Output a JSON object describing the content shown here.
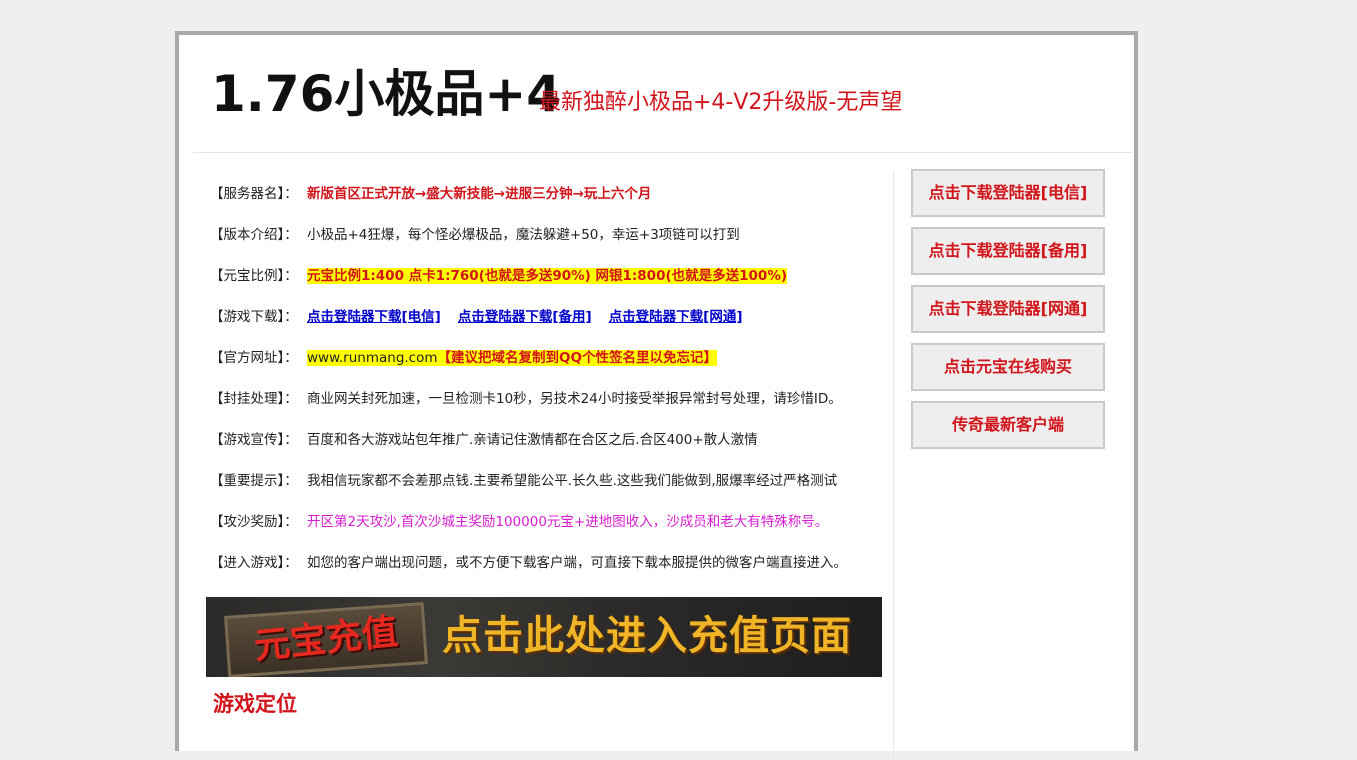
{
  "header": {
    "title": "1.76小极品+4",
    "subtitle": "最新独醉小极品+4-V2升级版-无声望"
  },
  "info": {
    "server_name": {
      "label": "【服务器名】：",
      "value": "新版首区正式开放→盛大新技能→进服三分钟→玩上六个月"
    },
    "version_intro": {
      "label": "【版本介绍】：",
      "value": "小极品+4狂爆，每个怪必爆极品，魔法躲避+50，幸运+3项链可以打到"
    },
    "ingot_ratio": {
      "label": "【元宝比例】：",
      "value": "元宝比例1:400 点卡1:760(也就是多送90%) 网银1:800(也就是多送100%)"
    },
    "game_download": {
      "label": "【游戏下载】：",
      "links": [
        "点击登陆器下载[电信]",
        "点击登陆器下载[备用]",
        "点击登陆器下载[网通]"
      ]
    },
    "official_site": {
      "label": "【官方网址】：",
      "url": "www.runmang.com",
      "note": "【建议把域名复制到QQ个性签名里以免忘记】"
    },
    "anti_cheat": {
      "label": "【封挂处理】：",
      "value": "商业网关封死加速，一旦检测卡10秒，另技术24小时接受举报异常封号处理，请珍惜ID。"
    },
    "promotion": {
      "label": "【游戏宣传】：",
      "value": "百度和各大游戏站包年推广.亲请记住激情都在合区之后.合区400+散人激情"
    },
    "important_note": {
      "label": "【重要提示】：",
      "value": "我相信玩家都不会差那点钱.主要希望能公平.长久些.这些我们能做到,服爆率经过严格测试"
    },
    "siege_reward": {
      "label": "【攻沙奖励】：",
      "value": "开区第2天攻沙,首次沙城主奖励100000元宝+进地图收入，沙成员和老大有特殊称号。"
    },
    "enter_game": {
      "label": "【进入游戏】：",
      "value": "如您的客户端出现问题，或不方便下载客户端，可直接下载本服提供的微客户端直接进入。"
    }
  },
  "banner": {
    "left_text": "元宝充值",
    "right_text": "点击此处进入充值页面"
  },
  "section": {
    "title": "游戏定位"
  },
  "sidebar": {
    "buttons": [
      "点击下载登陆器[电信]",
      "点击下载登陆器[备用]",
      "点击下载登陆器[网通]",
      "点击元宝在线购买",
      "传奇最新客户端"
    ]
  },
  "colors": {
    "accent_red": "#d2141b",
    "highlight_yellow": "#ffff00",
    "link_blue": "#0000cc",
    "magenta": "#d61ccf"
  }
}
